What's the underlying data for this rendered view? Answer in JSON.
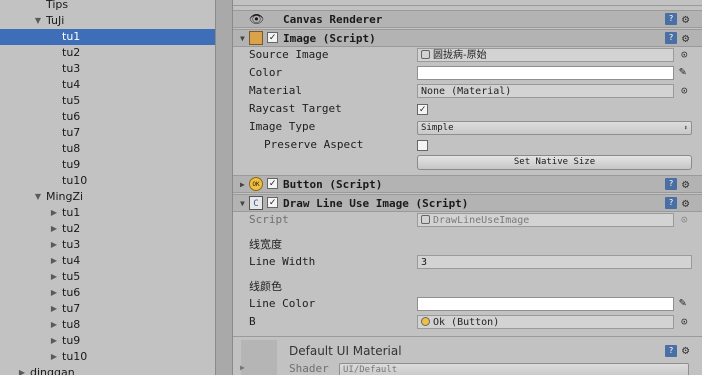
{
  "hierarchy": {
    "rows": [
      {
        "label": "Tips",
        "depth": 2,
        "expand": "none",
        "selected": false
      },
      {
        "label": "TuJi",
        "depth": 2,
        "expand": "open",
        "selected": false
      },
      {
        "label": "tu1",
        "depth": 3,
        "expand": "none",
        "selected": true
      },
      {
        "label": "tu2",
        "depth": 3,
        "expand": "none",
        "selected": false
      },
      {
        "label": "tu3",
        "depth": 3,
        "expand": "none",
        "selected": false
      },
      {
        "label": "tu4",
        "depth": 3,
        "expand": "none",
        "selected": false
      },
      {
        "label": "tu5",
        "depth": 3,
        "expand": "none",
        "selected": false
      },
      {
        "label": "tu6",
        "depth": 3,
        "expand": "none",
        "selected": false
      },
      {
        "label": "tu7",
        "depth": 3,
        "expand": "none",
        "selected": false
      },
      {
        "label": "tu8",
        "depth": 3,
        "expand": "none",
        "selected": false
      },
      {
        "label": "tu9",
        "depth": 3,
        "expand": "none",
        "selected": false
      },
      {
        "label": "tu10",
        "depth": 3,
        "expand": "none",
        "selected": false
      },
      {
        "label": "MingZi",
        "depth": 2,
        "expand": "open",
        "selected": false
      },
      {
        "label": "tu1",
        "depth": 3,
        "expand": "closed",
        "selected": false
      },
      {
        "label": "tu2",
        "depth": 3,
        "expand": "closed",
        "selected": false
      },
      {
        "label": "tu3",
        "depth": 3,
        "expand": "closed",
        "selected": false
      },
      {
        "label": "tu4",
        "depth": 3,
        "expand": "closed",
        "selected": false
      },
      {
        "label": "tu5",
        "depth": 3,
        "expand": "closed",
        "selected": false
      },
      {
        "label": "tu6",
        "depth": 3,
        "expand": "closed",
        "selected": false
      },
      {
        "label": "tu7",
        "depth": 3,
        "expand": "closed",
        "selected": false
      },
      {
        "label": "tu8",
        "depth": 3,
        "expand": "closed",
        "selected": false
      },
      {
        "label": "tu9",
        "depth": 3,
        "expand": "closed",
        "selected": false
      },
      {
        "label": "tu10",
        "depth": 3,
        "expand": "closed",
        "selected": false
      },
      {
        "label": "dinggan",
        "depth": 1,
        "expand": "closed",
        "selected": false
      }
    ]
  },
  "inspector": {
    "canvas_renderer": {
      "title": "Canvas Renderer",
      "icon": "eye-icon"
    },
    "image": {
      "title": "Image (Script)",
      "enabled": true,
      "source_image_label": "Source Image",
      "source_image_value": "圆拢病-原始",
      "color_label": "Color",
      "color_value": "#ffffff",
      "material_label": "Material",
      "material_value": "None (Material)",
      "raycast_label": "Raycast Target",
      "raycast_checked": true,
      "image_type_label": "Image Type",
      "image_type_value": "Simple",
      "preserve_label": "Preserve Aspect",
      "preserve_checked": false,
      "native_size_button": "Set Native Size"
    },
    "button": {
      "title": "Button (Script)",
      "enabled": true,
      "icon_text": "OK"
    },
    "draw_line": {
      "title": "Draw Line Use Image (Script)",
      "enabled": true,
      "script_label": "Script",
      "script_value": "DrawLineUseImage",
      "width_header": "线宽度",
      "line_width_label": "Line Width",
      "line_width_value": "3",
      "color_header": "线颜色",
      "line_color_label": "Line Color",
      "line_color_value": "#ffffff",
      "b_label": "B",
      "b_value": "Ok (Button)"
    },
    "material": {
      "title": "Default UI Material",
      "shader_label": "Shader",
      "shader_value": "UI/Default"
    }
  },
  "colors": {
    "selection": "#3d6eb7",
    "panel": "#c2c2c2",
    "header": "#b3b3b3"
  }
}
